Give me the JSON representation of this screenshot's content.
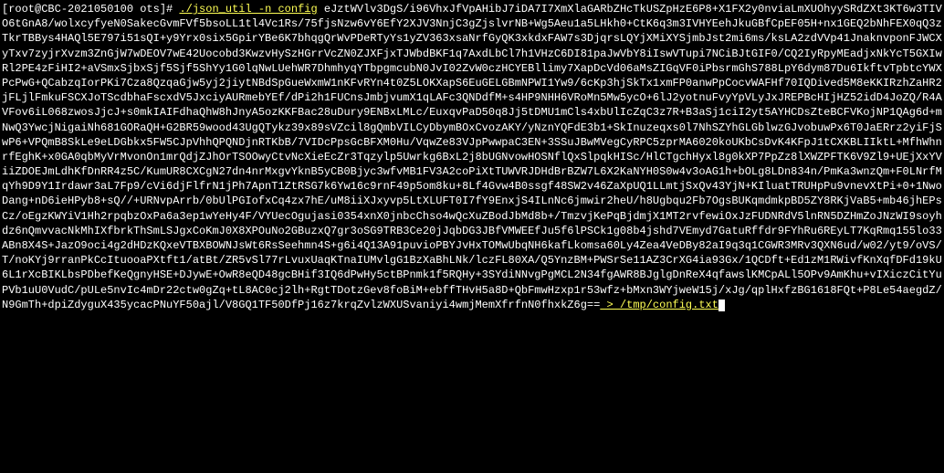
{
  "prompt": {
    "open": "[",
    "user_host": "root@CBC-2021050100 ots",
    "close": "]# "
  },
  "command": "./json_util -n config",
  "output": "eJztWVlv3DgS/i96VhxJfVpAHibJ7iDA7I7XmXlaGARbZHcTkUSZpHzE6P8+X1FX2y0nviaLmXUOhyySRdZXt3KT6w3TIVO6tGnA8/wolxcyfyeN0SakecGvmFVf5bsoLL1tl4Vc1Rs/75fjsNzw6vY6EfY2XJV3NnjC3gZjslvrNB+Wg5Aeu1a5LHkh0+CtK6q3m3IVHYEehJkuGBfCpEF05H+nx1GEQ2bNhFEX0qQ3zTkrTBBys4HAQl5E797i51sQI+y9Yrx0six5GpirYBe6K7bhqgQrWvPDeRTyYs1yZV363xsaNrfGyQK3xkdxFAW7s3DjqrsLQYjXMiXYSjmbJst2mi6ms/ksLA2zdVVp41JnaknvponFJWCXyTxv7zyjrXvzm3ZnGjW7wDEOV7wE42Uocobd3KwzvHySzHGrrVcZN0ZJXFjxTJWbdBKF1q7AxdLbCl7h1VHzC6DI81paJwVbY8iIswVTupi7NCiBJtGIF0/CQ2IyRpyMEadjxNkYcT5GXIwRl2PE4zFiHI2+aVSmxSjbxSjf5Sjf5ShYy1G0lqNwLUehWR7DhmhyqYTbpgmcubN0JvI02ZvW0czHCYEBllimy7XapDcVd06aMsZIGqVF0iPbsrmGhS788LpY6dym87Du6IkftvTpbtcYWXPcPwG+QCabzqIorPKi7Cza8QzqaGjw5yj2jiytNBdSpGueWxmW1nKFvRYn4t0Z5LOKXapS6EuGELGBmNPWI1Yw9/6cKp3hjSkTx1xmFP0anwPpCocvWAFHf70IQDived5M8eKKIRzhZaHR2jFLjlFmkuFSCXJoTScdbhaFscxdV5JxciyAURmebYEf/dPi2h1FUCnsJmbjvumX1qLAFc3QNDdfM+s4HP9NHH6VRoMn5Mw5ycO+6lJ2yotnuFvyYpVLyJxJREPBcHIjHZ52idD4JoZQ/R4AVFov6iL068zwosJjcJ+s0mkIAIFdhaQhW8hJnyA5ozKKFBac28uDury9ENBxLMLc/EuxqvPaD50q8Jj5tDMU1mCls4xbUlIcZqC3z7R+B3aSj1ciI2yt5AYHCDsZteBCFVKojNP1QAg6d+mNwQ3YwcjNigaiNh681GORaQH+G2BR59wood43UgQTykz39x89sVZcil8gQmbVILCyDbymBOxCvozAKY/yNznYQFdE3b1+SkInuzeqxs0l7NhSZYhGLGblwzGJvobuwPx6T0JaERrz2yiFjSwP6+VPQmB8SkLe9eLDGbkx5FW5CJpVhhQPQNDjnRTKbB/7VIDcPpsGcBFXM0Hu/VqwZe83VJpPwwpaC3EN+3SSuJBwMVegCyRPC5zprMA6020koUKbCsDvK4KFpJ1tCXKBLIIktL+MfhWhnrfEghK+x0GA0qbMyVrMvonOn1mrQdjZJhOrTSOOwyCtvNcXieEcZr3Tqzylp5Uwrkg6BxL2j8bUGNvowHOSNflQxSlpqkHISc/HlCTgchHyxl8g0kXP7PpZz8lXWZPFTK6V9Zl9+UEjXxYViiZDOEJmLdhKfDnRR4z5C/KumUR8CXCgN27dn4nrMxgvYknB5yCB0Bjyc3wfvMB1FV3A2coPiXtTUWVRJDHdBrBZW7L6X2KaNYH0S0w4v3oAG1h+bOLg8LDn834n/PmKa3wnzQm+F0LNrfMqYh9D9Y1Irdawr3aL7Fp9/cVi6djFlfrN1jPh7ApnT1ZtRSG7k6Yw16c9rnF49p5om8ku+8Lf4Gvw4B0ssgf48SW2v46ZaXpUQ1LLmtjSxQv43YjN+KIluatTRUHpPu9vnevXtPi+0+1NwoDang+nD6ieHPyb8+sQ//+URNvpArrb/0bUlPGIofxCq4zx7hE/uM8iiXJxyvp5LtXLUFT0I7fY9EnxjS4ILnNc6jmwir2heU/h8Ugbqu2Fb7OgsBUKqmdmkpBD5ZY8RKjVaB5+mb46jhEPsCz/oEgzKWYiV1Hh2rpqbzOxPa6a3ep1wYeHy4F/VYUecOgujasi0354xnX0jnbcChso4wQcXuZBodJbMd8b+/TmzvjKePqBjdmjX1MT2rvfewiOxJzFUDNRdV5lnRN5DZHmZoJNzWI9soyhdz6nQmvvacNkMhIXfbrkThSmLSJgxCoKmJ0X8XPOuNo2GBuzxQ7gr3oSG9TRB3Ce20jJqbDG3JBfVMWEEfJu5f6lPSCk1g08b4jshd7VEmyd7GatuRffdr9FYhRu6REyLT7KqRmq155lo33ABn8X4S+JazO9oci4g2dHDzKQxeVTBXBOWNJsWt6RsSeehmn4S+g6i4Q13A91puvioPBYJvHxTOMwUbqNH6kafLkomsa60Ly4Zea4VeDBy82aI9q3q1CGWR3MRv3QXN6ud/w02/yt9/oVS/T/noKYj9rranPkCcItuooaPXtft1/atBt/ZR5vSl77rLvuxUaqKTnaIUMvlgG1BzXaBhLNk/lczFL80XA/Q5YnzBM+PWSrSe11AZ3CrXG4ia93Gx/1QCDft+Ed1zM1RWivfKnXqfDFd19kU6L1rXcBIKLbsPDbefKeQgnyHSE+DJywE+OwR8eQD48gcBHif3IQ6dPwHy5ctBPnmk1f5RQHy+3SYdiNNvgPgMCL2N34fgAWR8BJglgDnReX4qfawslKMCpALl5OPv9AmKhu+vIXiczCitYuPVb1uU0VudC/pULe5nvIc4mDr22ctw0gZq+tL8AC0cj2lh+RgtTDotzGev8foBiM+ebffTHvH5a8D+QbFmwHzxp1r53wfz+bMxn3WYjweW15j/xJg/qplHxfzBG1618FQt+P8Le54aegdZ/N9GmTh+dpiZdyguX435ycacPNuYF50ajl/V8GQ1TF50DfPj16z7krqZvlzWXUSvaniyi4wmjMemXfrfnN0fhxkZ6g==",
  "redirect": " > /tmp/config.txt"
}
